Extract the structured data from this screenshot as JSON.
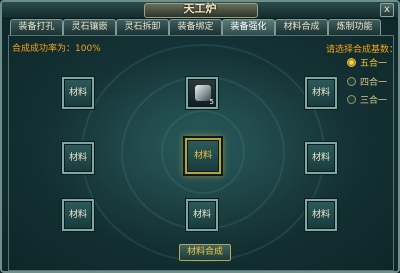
{
  "window": {
    "title": "天工炉",
    "close_label": "x"
  },
  "tabs": [
    {
      "label": "装备打孔",
      "active": false
    },
    {
      "label": "灵石镶嵌",
      "active": false
    },
    {
      "label": "灵石拆卸",
      "active": false
    },
    {
      "label": "装备绑定",
      "active": false
    },
    {
      "label": "装备强化",
      "active": true
    },
    {
      "label": "材料合成",
      "active": false
    },
    {
      "label": "炼制功能",
      "active": false
    }
  ],
  "success_rate": "合成成功率为：100%",
  "choose": {
    "label": "请选择合成基数：",
    "options": [
      {
        "label": "五合一",
        "selected": true
      },
      {
        "label": "四合一",
        "selected": false
      },
      {
        "label": "三合一",
        "selected": false
      }
    ]
  },
  "slots": {
    "material_label": "材料",
    "item_count": "5",
    "item_icon": "gem-stack-icon"
  },
  "merge_button": "材料合成",
  "colors": {
    "accent": "#f0a31a",
    "frame": "#7fa7a1",
    "center_frame": "#b9a23e"
  }
}
